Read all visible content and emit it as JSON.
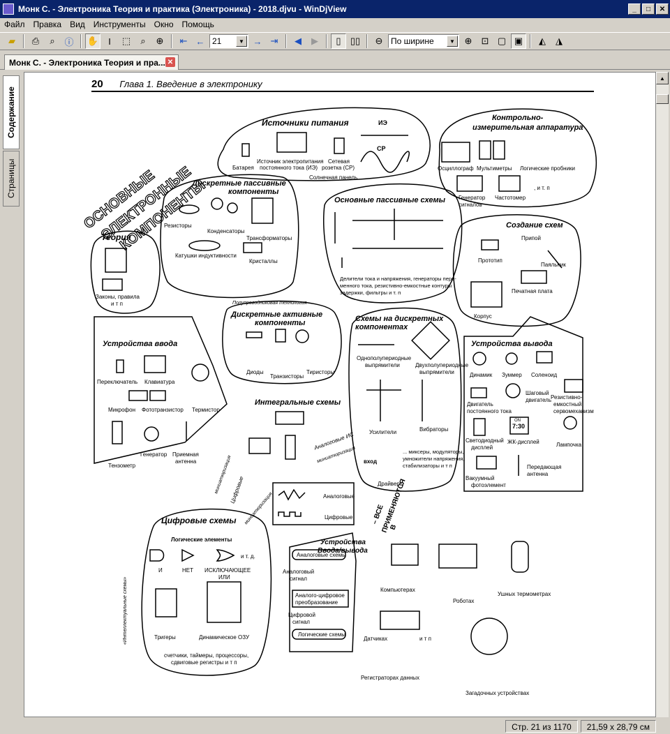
{
  "window": {
    "title": "Монк С. - Электроника Теория и практика (Электроника) - 2018.djvu - WinDjView"
  },
  "menu": [
    "Файл",
    "Правка",
    "Вид",
    "Инструменты",
    "Окно",
    "Помощь"
  ],
  "toolbar": {
    "page_value": "21",
    "zoom_value": "По ширине"
  },
  "tab": {
    "label": "Монк С. - Электроника Теория и пра..."
  },
  "sidebar": {
    "tabs": [
      "Содержание",
      "Страницы"
    ]
  },
  "status": {
    "page": "Стр. 21 из 1170",
    "size": "21,59 x 28,79 см"
  },
  "page": {
    "number": "20",
    "header": "Глава 1. Введение в электронику",
    "big_title": [
      "ОСНОВНЫЕ",
      "ЭЛЕКТРОННЫЕ",
      "КОМПОНЕНТЫ"
    ],
    "sections": {
      "power": "Источники питания",
      "power_items": [
        "Батарея",
        "Источник электропитания",
        "постоянного тока (ИЭ)",
        "Сетевая",
        "розетка (СР)",
        "Солнечная панель",
        "ИЭ",
        "СР"
      ],
      "instr": [
        "Контрольно-",
        "измерительная аппаратура"
      ],
      "instr_items": [
        "Осциллограф",
        "Мультиметры",
        "Логические пробники",
        "Генератор",
        "сигналов",
        "Частотомер",
        ", и т. п"
      ],
      "passive": [
        "Дискретные пассивные",
        "компоненты"
      ],
      "passive_items": [
        "Резисторы",
        "Конденсаторы",
        "Трансформаторы",
        "Катушки индуктивности",
        "Кристаллы"
      ],
      "theory": "Теория",
      "theory_items": [
        "Законы, правила",
        "и т п"
      ],
      "basic_circuits": "Основные пассивные схемы",
      "basic_circuits_text": [
        "Делители тока и напряжения, генераторы пере-",
        "менного тока, резистивно-емкостные контуры",
        "задержки, фильтры и т. п"
      ],
      "build": "Создание схем",
      "build_items": [
        "Припой",
        "Прототип",
        "Паяльник",
        "Печатная плата",
        "Корпус"
      ],
      "semi_tech": "Полупроводниковая технология",
      "active": [
        "Дискретные активные",
        "компоненты"
      ],
      "active_items": [
        "Диоды",
        "Транзисторы",
        "Тиристоры"
      ],
      "discrete_circuits": [
        "Схемы на дискретных",
        "компонентах"
      ],
      "discrete_items": [
        "Однополупериодные",
        "выпрямители",
        "Двухполупериодные",
        "выпрямители",
        "Усилители",
        "Вибраторы",
        "Драйверы",
        "... миксеры, модуляторы,",
        "умножители напряжения,",
        "стабилизаторы и т п",
        "вход"
      ],
      "input": "Устройства ввода",
      "input_items": [
        "Переключатель",
        "Клавиатура",
        "Микрофон",
        "Фототранзистор",
        "Термистор",
        "Тензометр",
        "Генератор",
        "Приемная",
        "антенна"
      ],
      "output": "Устройства вывода",
      "output_items": [
        "Динамик",
        "Зуммер",
        "Соленоид",
        "Двигатель",
        "постоянного тока",
        "Шаговый",
        "двигатель",
        "Резистивно-",
        "емкостный",
        "сервомеханизм",
        "Светодиодный",
        "дисплей",
        "ЖК-дисплей",
        "Лампочка",
        "Вакуумный",
        "фотоэлемент",
        "Передающая",
        "антенна",
        "7:30",
        "ON"
      ],
      "ic": "Интегральные схемы",
      "ic_arrows": [
        "Аналоговые ИС",
        "миниатюризация",
        "Цифровые",
        "миниатюризация",
        "миниатюризация"
      ],
      "signals": [
        "Аналоговые",
        "Цифровые"
      ],
      "digital": "Цифровые схемы",
      "digital_items": [
        "Логические элементы",
        "И",
        "НЕТ",
        "ИСКЛЮЧАЮЩЕЕ",
        "ИЛИ",
        "и т. д.",
        "Тригеры",
        "Динамическое ОЗУ",
        "счетчики, таймеры, процессоры,",
        "сдвиговые регистры и т п",
        "«Интеллектуальные схемы»"
      ],
      "io": [
        "Устройства",
        "Ввода/вывода"
      ],
      "io_items": [
        "Аналоговые схемы",
        "Аналоговый",
        "сигнал",
        "Аналого-цифровое",
        "преобразование",
        "Цифровой",
        "сигнал",
        "Логические схемы"
      ],
      "apply": [
        "– ВСЕ",
        "ПРИМЕНЯЮТСЯ",
        "В"
      ],
      "apply_items": [
        "Компьютерах",
        "Роботах",
        "Ушных термометрах",
        "Датчиках",
        "и т п",
        "Регистраторах данных",
        "Загадочных устройствах"
      ]
    }
  }
}
